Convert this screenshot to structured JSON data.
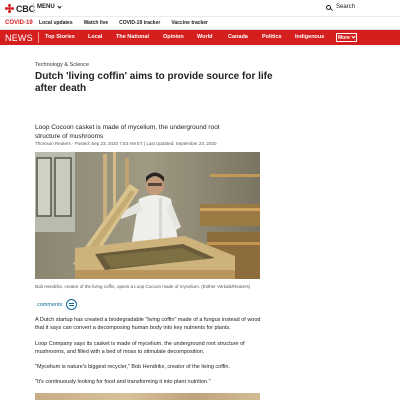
{
  "header": {
    "logo_text": "CBC",
    "menu_label": "MENU",
    "search_label": "Search"
  },
  "subnav": {
    "covid_label": "COVID-19",
    "links": [
      "Local updates",
      "Watch live",
      "COVID-19 tracker",
      "Vaccine tracker"
    ]
  },
  "nav": {
    "section": "NEWS",
    "items": [
      "Top Stories",
      "Local",
      "The National",
      "Opinion",
      "World",
      "Canada",
      "Politics",
      "Indigenous"
    ],
    "more_label": "More"
  },
  "article": {
    "category": "Technology & Science",
    "headline": "Dutch 'living coffin' aims to provide source for life after death",
    "deck": "Loop Cocoon casket is made of mycelium, the underground root structure of mushrooms",
    "byline": "Thomson Reuters · Posted: Sep 23, 2020 7:53 AM ET | Last Updated: September 23, 2020",
    "photo_caption": "Bob Hendrikx, creator of the living coffin, opens a Loop Cocoon made of mycelium. (Esther Verkaik/Reuters)",
    "comments_label": "comments",
    "paragraphs": [
      "A Dutch startup has created a biodegradable \"living coffin\" made of a fungus instead of wood that it says can convert a decomposing human body into key nutrients for plants.",
      "Loop Company says its casket is made of mycelium, the underground root structure of mushrooms, and filled with a bed of moss to stimulate decomposition.",
      "\"Mycelium is nature's biggest recycler,\" Bob Hendrikx, creator of the living coffin.",
      "\"It's continuously looking for food and transforming it into plant nutrition.\""
    ]
  },
  "colors": {
    "brand_red": "#d51e1e",
    "link_blue": "#0d6a9c"
  },
  "icons": {
    "logo": "cbc-gem-icon",
    "menu": "chevron-down-icon",
    "search": "search-icon",
    "comments": "comment-bubble-icon",
    "more": "chevron-down-icon"
  }
}
